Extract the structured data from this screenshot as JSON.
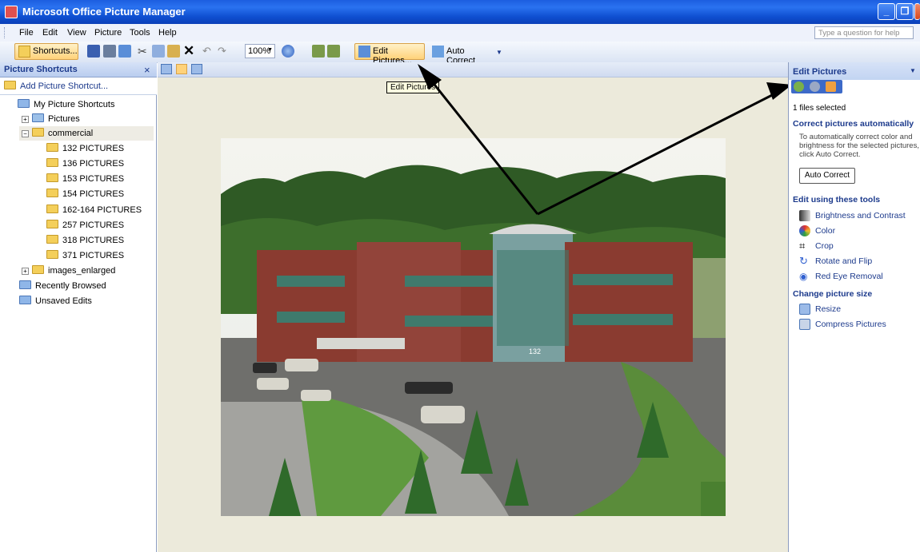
{
  "window": {
    "title": "Microsoft Office Picture Manager"
  },
  "menu": [
    "File",
    "Edit",
    "View",
    "Picture",
    "Tools",
    "Help"
  ],
  "help_box": {
    "placeholder": "Type a question for help"
  },
  "toolbar": {
    "shortcuts_label": "Shortcuts...",
    "zoom_value": "100%",
    "edit_pictures_label": "Edit Pictures...",
    "auto_correct_label": "Auto Correct"
  },
  "tooltip": "Edit Pictures",
  "left_panel": {
    "title": "Picture Shortcuts",
    "add_shortcut": "Add Picture Shortcut...",
    "my_shortcuts": "My Picture Shortcuts",
    "pictures": "Pictures",
    "commercial": "commercial",
    "folders": [
      "132 PICTURES",
      "136 PICTURES",
      "153 PICTURES",
      "154 PICTURES",
      "162-164 PICTURES",
      "257 PICTURES",
      "318 PICTURES",
      "371 PICTURES"
    ],
    "images_enlarged": "images_enlarged",
    "recently_browsed": "Recently Browsed",
    "unsaved_edits": "Unsaved Edits"
  },
  "right_panel": {
    "title": "Edit Pictures",
    "files_selected": "1 files selected",
    "correct_heading": "Correct pictures automatically",
    "correct_desc": "To automatically correct color and brightness for the selected pictures, click Auto Correct.",
    "auto_correct_button": "Auto Correct",
    "tools_heading": "Edit using these tools",
    "tools": [
      "Brightness and Contrast",
      "Color",
      "Crop",
      "Rotate and Flip",
      "Red Eye Removal"
    ],
    "size_heading": "Change picture size",
    "size_tools": [
      "Resize",
      "Compress Pictures"
    ]
  },
  "photo": {
    "building_number": "132"
  },
  "colors": {
    "titlebar": "#2a72f0",
    "panel_heading": "#1c3a8c",
    "highlight": "#ffd27a"
  }
}
